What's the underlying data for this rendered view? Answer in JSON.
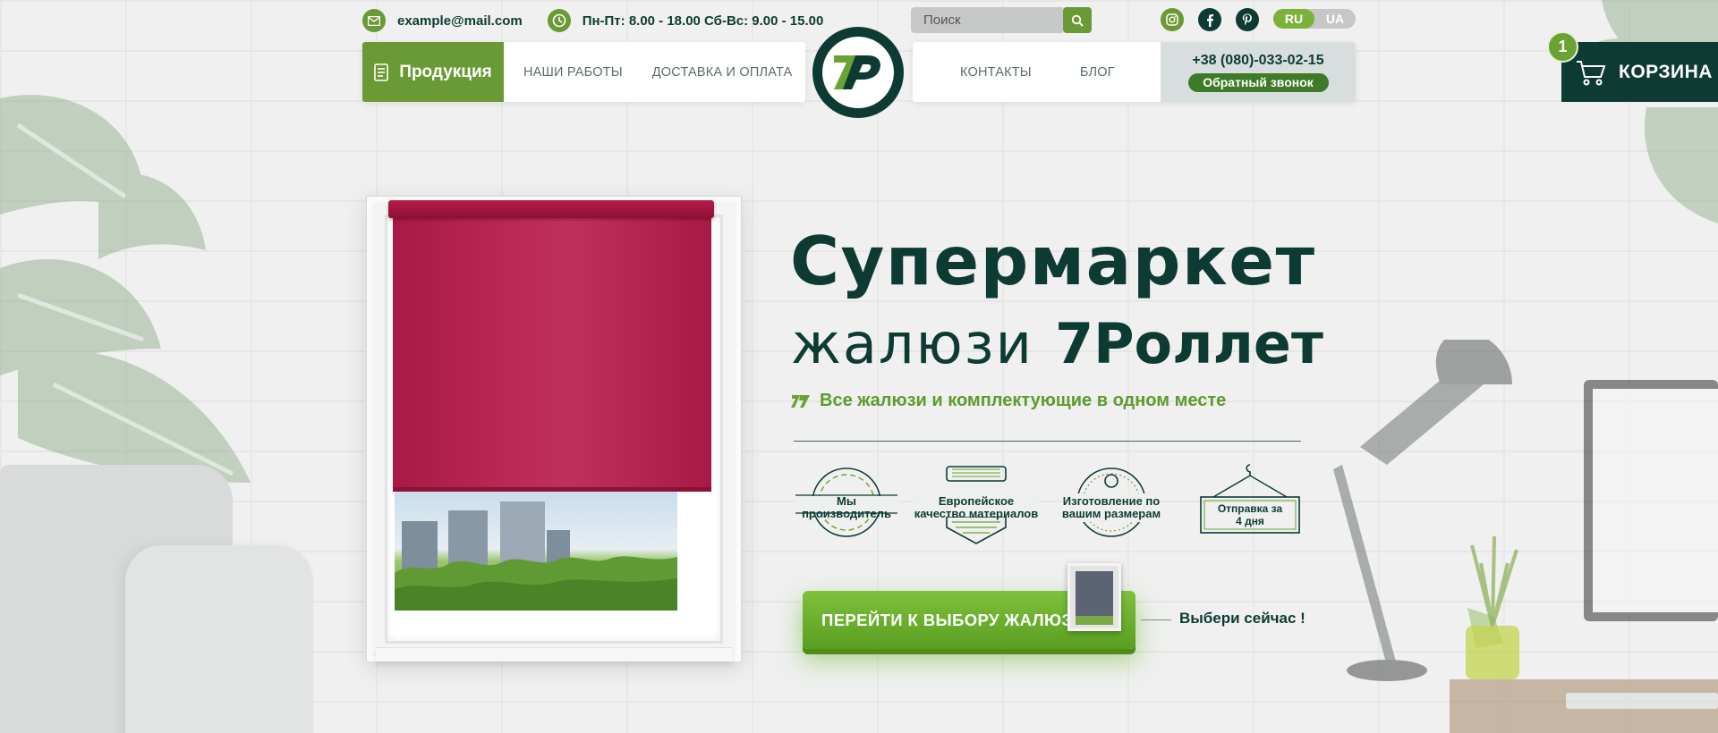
{
  "topbar": {
    "email": "example@mail.com",
    "hours": "Пн-Пт: 8.00 - 18.00 Сб-Вс: 9.00 - 15.00",
    "search_placeholder": "Поиск",
    "languages": [
      "RU",
      "UA"
    ],
    "active_language": "RU",
    "socials": [
      "instagram-icon",
      "facebook-icon",
      "pinterest-icon"
    ]
  },
  "nav": {
    "products_label": "Продукция",
    "left_links": [
      "НАШИ РАБОТЫ",
      "ДОСТАВКА И ОПЛАТА"
    ],
    "right_links": [
      "КОНТАКТЫ",
      "БЛОГ"
    ],
    "phone": "+38 (080)-033-02-15",
    "callback_label": "Обратный звонок",
    "logo_text": "7P"
  },
  "cart": {
    "label": "КОРЗИНА",
    "count": "1"
  },
  "hero": {
    "title": "Супермаркет",
    "subtitle_light": "жалюзи",
    "subtitle_bold": "7Роллет",
    "tagline": "Все жалюзи и комплектующие в одном месте",
    "features": [
      "Мы производитель",
      "Европейское качество материалов",
      "Изготовление по вашим размерам",
      "Отправка за 4 дня"
    ],
    "cta_label": "ПЕРЕЙТИ К ВЫБОРУ  ЖАЛЮЗИ",
    "cta_note": "Выбери сейчас !"
  },
  "colors": {
    "dark_green": "#0d3b33",
    "accent_green": "#6a9a35",
    "cta_green": "#6db02e",
    "blind_red": "#b5204f"
  }
}
